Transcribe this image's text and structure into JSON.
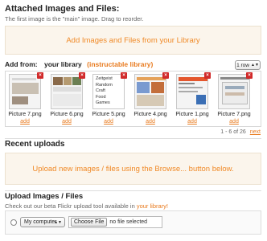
{
  "attached": {
    "title": "Attached Images and Files:",
    "note": "The first image is the \"main\" image. Drag to reorder.",
    "dropzone_text": "Add Images and Files from your Library"
  },
  "add_from": {
    "label": "Add from:",
    "your_library": "your library",
    "instructable_library": "(instructable library)",
    "rows_select": "1 row"
  },
  "library_items": [
    {
      "name": "Picture 7.png",
      "add": "add"
    },
    {
      "name": "Picture 6.png",
      "add": "add"
    },
    {
      "name": "Picture 5.png",
      "add": "add",
      "menu": [
        "Zeitgeist",
        "Random",
        "Craft",
        "Food",
        "Games"
      ]
    },
    {
      "name": "Picture 4.png",
      "add": "add"
    },
    {
      "name": "Picture 1.png",
      "add": "add"
    },
    {
      "name": "Picture 7.png",
      "add": "add"
    }
  ],
  "pager": {
    "range": "1 - 6 of 26",
    "next": "next"
  },
  "recent": {
    "title": "Recent uploads",
    "dropzone_text": "Upload new images / files using the Browse... button below."
  },
  "upload": {
    "title": "Upload Images / Files",
    "note_prefix": "Check out our beta Flickr upload tool available in ",
    "note_link": "your library!",
    "source_select": "My computer",
    "choose_file": "Choose File",
    "no_file": "no file selected"
  },
  "colors": {
    "accent": "#e87a1e",
    "dropzone_bg": "#fbf5ec",
    "close_red": "#d12a2a"
  }
}
